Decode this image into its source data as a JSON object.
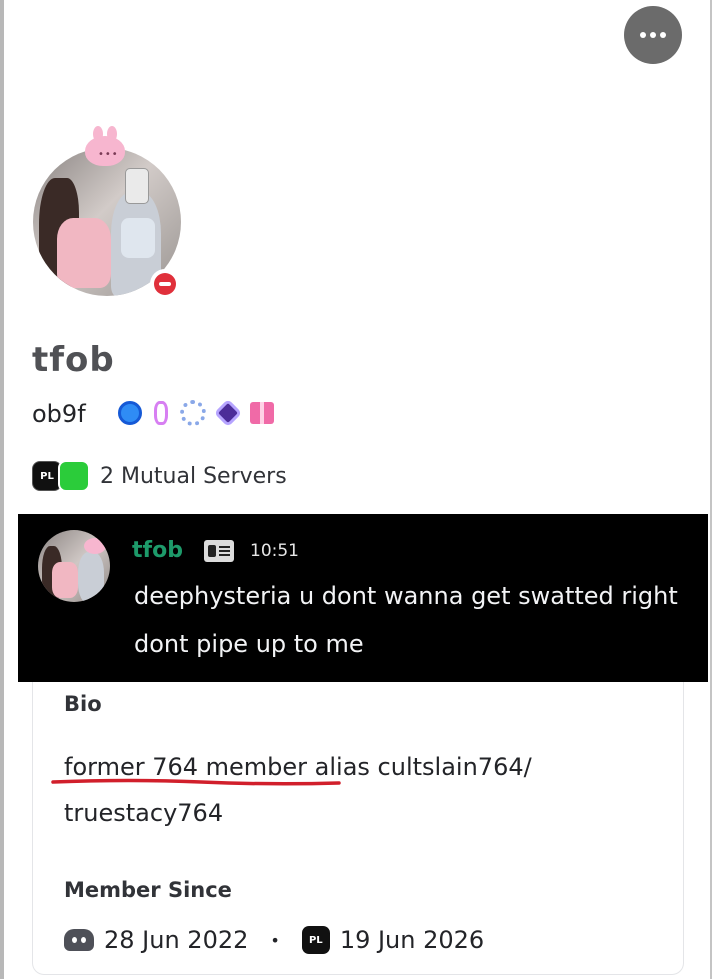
{
  "profile": {
    "display_name": "tfob",
    "username": "ob9f",
    "status": "do-not-disturb",
    "badges": [
      "nitro-icon",
      "gem-icon",
      "laurel-icon",
      "quest-icon",
      "gift-icon"
    ]
  },
  "header": {
    "more_label": "more-options"
  },
  "mutual": {
    "servers": [
      {
        "icon": "PL",
        "color": "#111111"
      },
      {
        "icon": "",
        "color": "#2bcc3a"
      }
    ],
    "label": "2 Mutual Servers"
  },
  "message": {
    "author": "tfob",
    "time": "10:51",
    "lines": [
      "deephysteria u dont wanna get swatted right",
      "dont pipe up to me"
    ]
  },
  "bio": {
    "heading": "Bio",
    "text_line1": "former 764 member alias cultslain764/",
    "text_line2": "truestacy764",
    "underline_color": "#d11f2b"
  },
  "member_since": {
    "heading": "Member Since",
    "discord_date": "28 Jun 2022",
    "separator": "•",
    "server_icon": "PL",
    "server_date": "19 Jun 2026"
  },
  "colors": {
    "author_green": "#1d9a6a",
    "dnd_red": "#e0303b"
  }
}
